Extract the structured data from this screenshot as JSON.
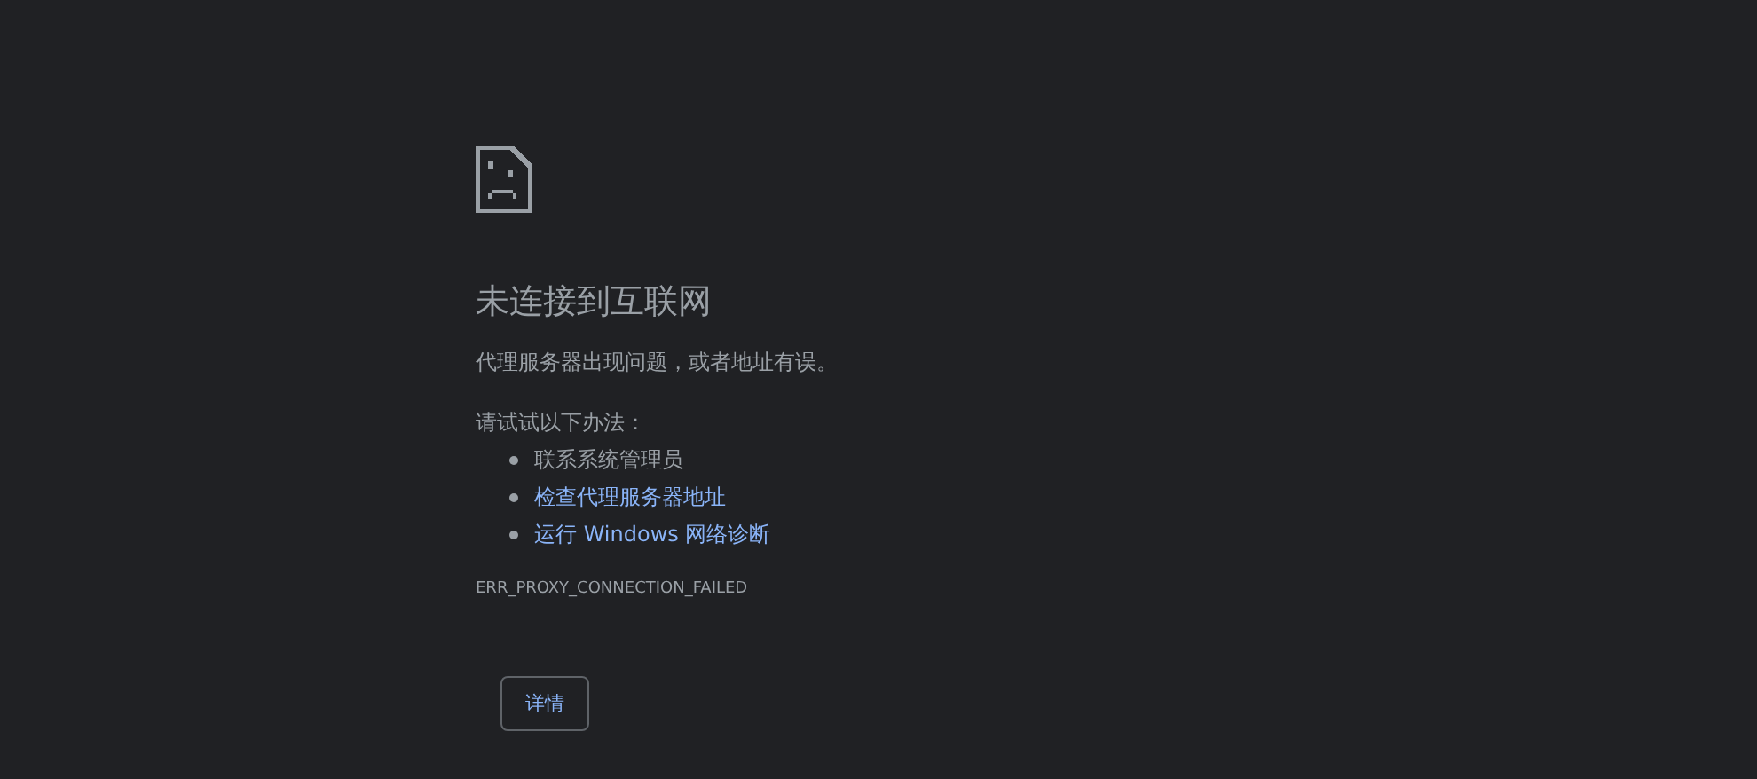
{
  "title": "未连接到互联网",
  "message": "代理服务器出现问题，或者地址有误。",
  "suggestions_heading": "请试试以下办法：",
  "suggestions": [
    {
      "text": "联系系统管理员",
      "kind": "text"
    },
    {
      "text": "检查代理服务器地址",
      "kind": "link"
    },
    {
      "text": "运行 Windows 网络诊断",
      "kind": "link"
    }
  ],
  "error_code": "ERR_PROXY_CONNECTION_FAILED",
  "details_button": "详情"
}
